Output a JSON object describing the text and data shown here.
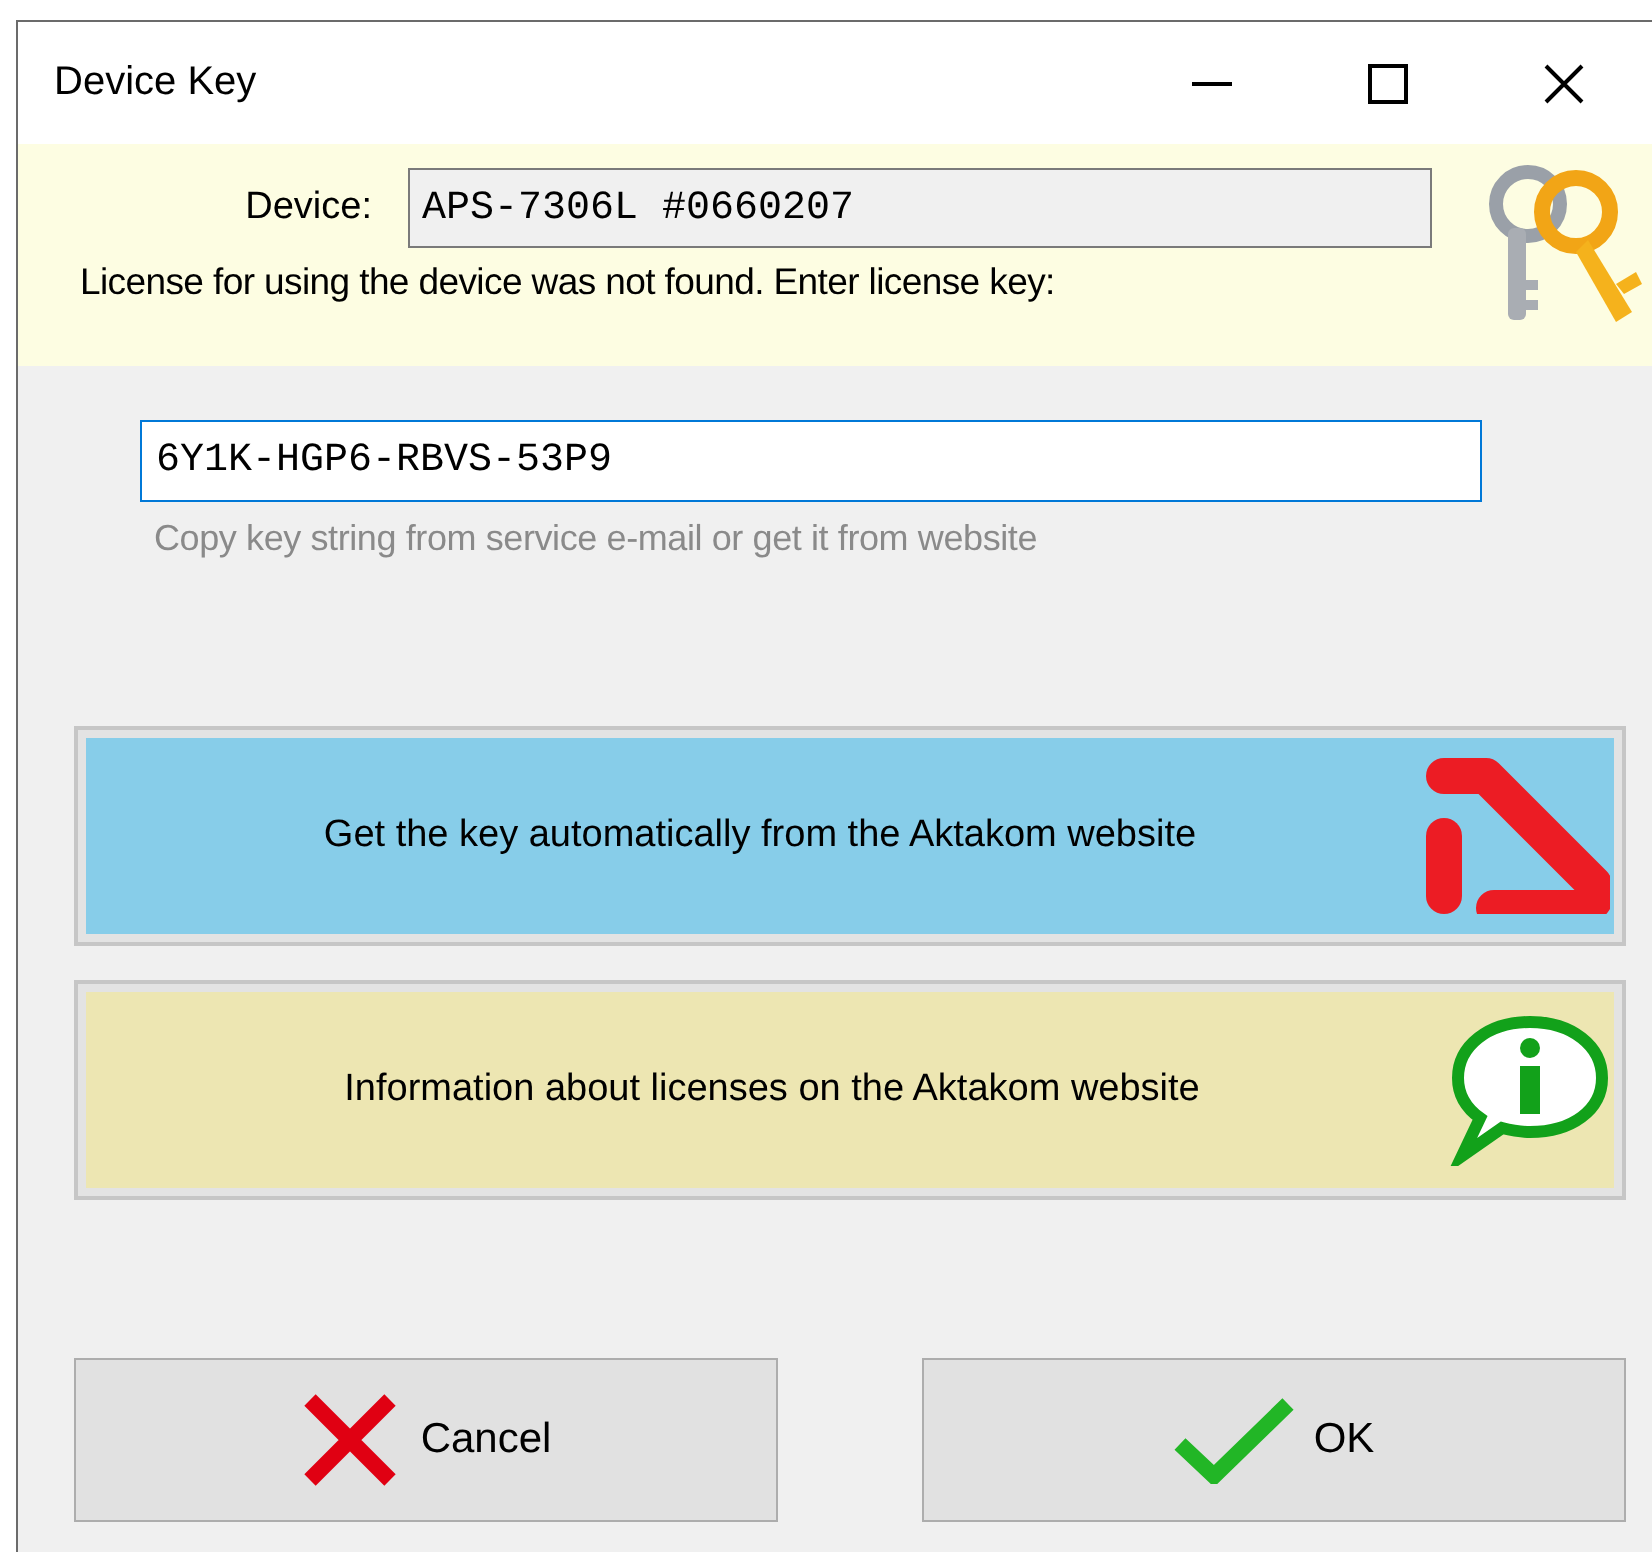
{
  "window": {
    "title": "Device Key"
  },
  "device": {
    "label": "Device:",
    "value": "APS-7306L #0660207"
  },
  "message": "License for using the device was not found. Enter license key:",
  "license_key": {
    "value": "6Y1K-HGP6-RBVS-53P9",
    "focused": true,
    "hint": "Copy key string from service e-mail or get it from website"
  },
  "link_buttons": [
    {
      "label": "Get the key automatically from the Aktakom website",
      "kind": "logo",
      "color": "#87cde9"
    },
    {
      "label": "Information about licenses on the Aktakom website",
      "kind": "info",
      "color": "#ede6b2"
    }
  ],
  "buttons": [
    {
      "label": "Cancel",
      "kind": "cancel"
    },
    {
      "label": "OK",
      "kind": "ok"
    }
  ]
}
